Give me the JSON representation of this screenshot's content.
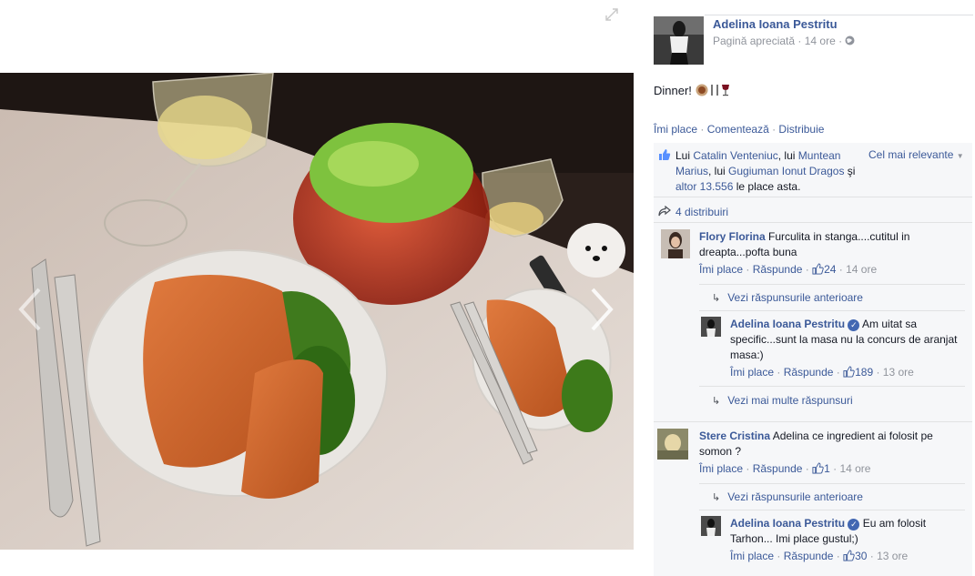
{
  "post": {
    "page_name": "Adelina Ioana Pestritu",
    "page_meta": "Pagină apreciată · 14 ore · ",
    "text": "Dinner! ",
    "actions": {
      "like": "Îmi place",
      "comment": "Comentează",
      "share": "Distribuie",
      "dot": " · "
    }
  },
  "likes": {
    "lui1": "Lui ",
    "name1": "Catalin Venteniuc",
    "sep1": ", lui ",
    "name2": "Muntean Marius",
    "sep2": ", lui ",
    "name3": "Gugiuman Ionut Dragos",
    "and": " şi ",
    "others": "altor 13.556",
    "suffix": " le place asta.",
    "sort_label": "Cel mai relevante"
  },
  "shares": {
    "text": "4 distribuiri"
  },
  "comments": [
    {
      "author": "Flory Florina",
      "text": " Furculita in stanga....cutitul in dreapta...pofta buna",
      "like": "Îmi place",
      "reply": "Răspunde",
      "likes": "24",
      "time": "14 ore"
    },
    {
      "author": "Stere Cristina",
      "text": " Adelina ce ingredient ai folosit pe somon ?",
      "like": "Îmi place",
      "reply": "Răspunde",
      "likes": "1",
      "time": "14 ore"
    }
  ],
  "replies": [
    {
      "author": "Adelina Ioana Pestritu",
      "text": " Am uitat sa specific...sunt la masa nu la concurs de aranjat masa:)",
      "like": "Îmi place",
      "reply": "Răspunde",
      "likes": "189",
      "time": "13 ore"
    },
    {
      "author": "Adelina Ioana Pestritu",
      "text": " Eu am folosit Tarhon... Imi place gustul;)",
      "like": "Îmi place",
      "reply": "Răspunde",
      "likes": "30",
      "time": "13 ore"
    }
  ],
  "more_links": {
    "previous": "Vezi răspunsurile anterioare",
    "more": "Vezi mai multe răspunsuri"
  },
  "colors": {
    "link": "#3b5998",
    "muted": "#90949c",
    "ufi_bg": "#f6f7f9",
    "verified": "#4267b2"
  }
}
